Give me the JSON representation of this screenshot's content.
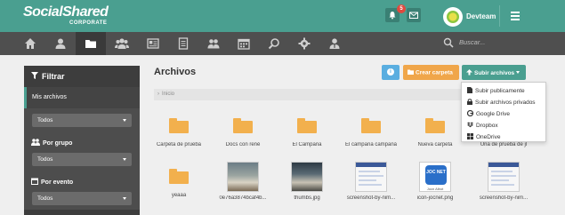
{
  "header": {
    "logo_main": "SocialShared",
    "logo_sub": "CORPORATE",
    "notification_count": "5",
    "user_name": "Devteam"
  },
  "nav": {
    "icons": [
      "home-icon",
      "user-icon",
      "folder-icon",
      "group-icon",
      "id-card-icon",
      "list-icon",
      "users-icon",
      "calendar-icon",
      "search-icon",
      "gear-icon",
      "admin-icon"
    ],
    "search_placeholder": "Buscar..."
  },
  "sidebar": {
    "title": "Filtrar",
    "my_files": "Mis archivos",
    "select1": "Todos",
    "by_group_label": "Por grupo",
    "select2": "Todos",
    "by_event_label": "Por evento",
    "select3": "Todos"
  },
  "main": {
    "title": "Archivos",
    "create_folder": "Crear carpeta",
    "upload_files": "Subir archivos",
    "breadcrumb": "Inicio"
  },
  "upload_menu": {
    "items": [
      "Subir publicamente",
      "Subir archivos privados",
      "Google Drive",
      "Dropbox",
      "OneDrive"
    ]
  },
  "files": {
    "row1": [
      "Carpeta de prueba",
      "Docs con rené",
      "El Campana",
      "El campana campaná",
      "Nueva carpeta",
      "Una de prueba de jl"
    ],
    "row2": [
      "yeaaa",
      "0e76a3874bcaf4b...",
      "thumbs.jpg",
      "screenshot-by-nim...",
      "icon-jocnet.png",
      "screenshot-by-nim..."
    ],
    "logo_text": "JOC NET",
    "logo_caption": "Jocn Albot"
  },
  "colors": {
    "brand": "#4a9f90",
    "nav": "#4f4f4f",
    "sidebar": "#4d4d4d",
    "folder": "#f2b04d",
    "info": "#5aaee0",
    "create": "#f0a64a"
  }
}
